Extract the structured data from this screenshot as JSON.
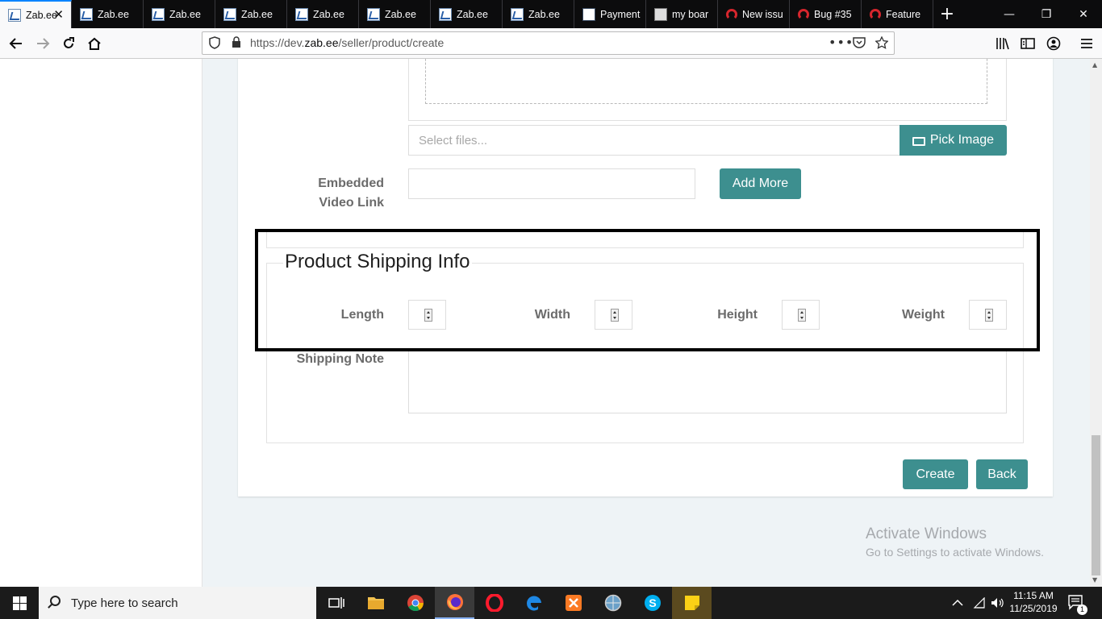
{
  "browser": {
    "tabs": [
      {
        "label": "Zab.ee",
        "favicon": "zab",
        "active": true
      },
      {
        "label": "Zab.ee",
        "favicon": "zab",
        "active": false
      },
      {
        "label": "Zab.ee",
        "favicon": "zab",
        "active": false
      },
      {
        "label": "Zab.ee",
        "favicon": "zab",
        "active": false
      },
      {
        "label": "Zab.ee",
        "favicon": "zab",
        "active": false
      },
      {
        "label": "Zab.ee",
        "favicon": "zab",
        "active": false
      },
      {
        "label": "Zab.ee",
        "favicon": "zab",
        "active": false
      },
      {
        "label": "Zab.ee",
        "favicon": "zab",
        "active": false
      },
      {
        "label": "Payment",
        "favicon": "pay",
        "active": false
      },
      {
        "label": "my boar",
        "favicon": "board",
        "active": false
      },
      {
        "label": "New issu",
        "favicon": "bug",
        "active": false
      },
      {
        "label": "Bug #35",
        "favicon": "bug",
        "active": false
      },
      {
        "label": "Feature",
        "favicon": "bug",
        "active": false
      }
    ],
    "url_prefix": "https://dev.",
    "url_domain": "zab.ee",
    "url_path": "/seller/product/create",
    "icons": {
      "back": "arrow-left-icon",
      "forward": "arrow-right-icon",
      "reload": "reload-icon",
      "home": "home-icon"
    }
  },
  "form": {
    "file_placeholder": "Select files...",
    "pick_image_label": "Pick Image",
    "video_label": "Embedded Video Link",
    "add_more_label": "Add More",
    "shipping_section_title": "Product Shipping Info",
    "length_label": "Length",
    "width_label": "Width",
    "height_label": "Height",
    "weight_label": "Weight",
    "shipping_note_label": "Shipping Note",
    "create_label": "Create",
    "back_label": "Back"
  },
  "watermark": {
    "line1": "Activate Windows",
    "line2": "Go to Settings to activate Windows."
  },
  "taskbar": {
    "search_placeholder": "Type here to search",
    "time": "11:15 AM",
    "date": "11/25/2019",
    "notification_count": "1"
  },
  "colors": {
    "accent": "#3d8f8f",
    "tab_active_line": "#0a84ff"
  }
}
